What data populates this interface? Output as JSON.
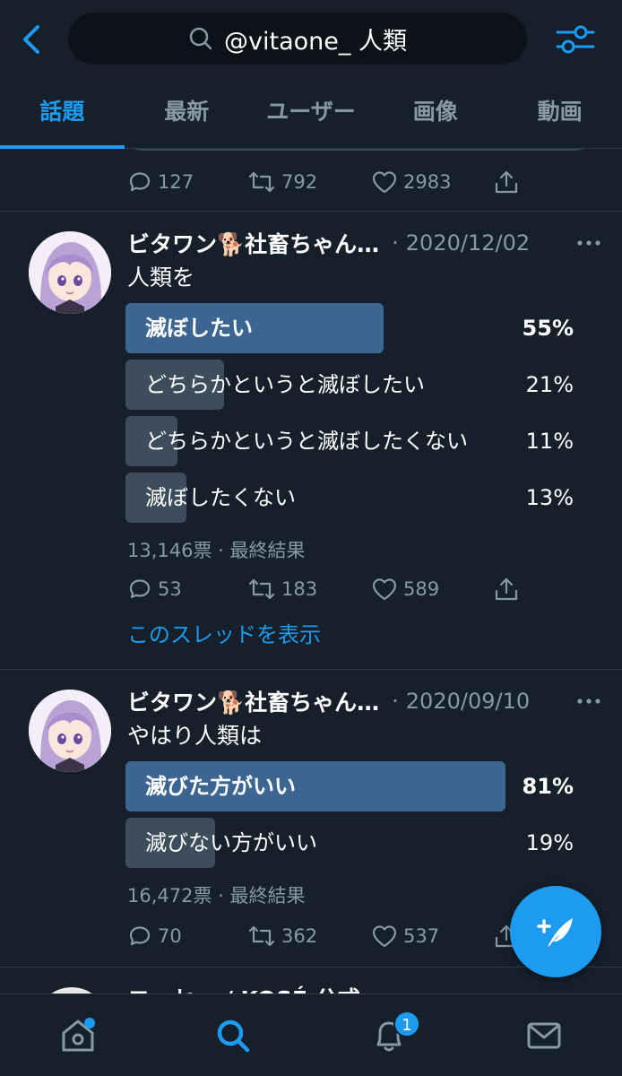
{
  "search": {
    "query": "@vitaone_  人類"
  },
  "tabs": [
    {
      "label": "話題",
      "active": true
    },
    {
      "label": "最新",
      "active": false
    },
    {
      "label": "ユーザー",
      "active": false
    },
    {
      "label": "画像",
      "active": false
    },
    {
      "label": "動画",
      "active": false
    }
  ],
  "prev_tweet": {
    "replies": "127",
    "retweets": "792",
    "likes": "2983"
  },
  "tweets": [
    {
      "author": "ビタワン🐕社畜ちゃん…",
      "date": "2020/12/02",
      "text": "人類を",
      "poll": [
        {
          "label": "滅ぼしたい",
          "percent": 55,
          "percent_text": "55%",
          "winner": true
        },
        {
          "label": "どちらかというと滅ぼしたい",
          "percent": 21,
          "percent_text": "21%",
          "winner": false
        },
        {
          "label": "どちらかというと滅ぼしたくない",
          "percent": 11,
          "percent_text": "11%",
          "winner": false
        },
        {
          "label": "滅ぼしたくない",
          "percent": 13,
          "percent_text": "13%",
          "winner": false
        }
      ],
      "poll_meta": "13,146票 · 最終結果",
      "replies": "53",
      "retweets": "183",
      "likes": "589",
      "thread_link": "このスレッドを表示"
    },
    {
      "author": "ビタワン🐕社畜ちゃん…",
      "date": "2020/09/10",
      "text": "やはり人類は",
      "poll": [
        {
          "label": "滅びた方がいい",
          "percent": 81,
          "percent_text": "81%",
          "winner": true
        },
        {
          "label": "滅びない方がいい",
          "percent": 19,
          "percent_text": "19%",
          "winner": false
        }
      ],
      "poll_meta": "16,472票 · 最終結果",
      "replies": "70",
      "retweets": "362",
      "likes": "537"
    }
  ],
  "next_tweet": {
    "author_partial": "コーセー / KOSÉ 公式"
  },
  "bottom_nav": {
    "notification_count": "1"
  },
  "colors": {
    "background": "#15202b",
    "accent": "#1d9bf0",
    "poll_winner": "#3c6592",
    "poll_other": "#3d4d5c"
  }
}
